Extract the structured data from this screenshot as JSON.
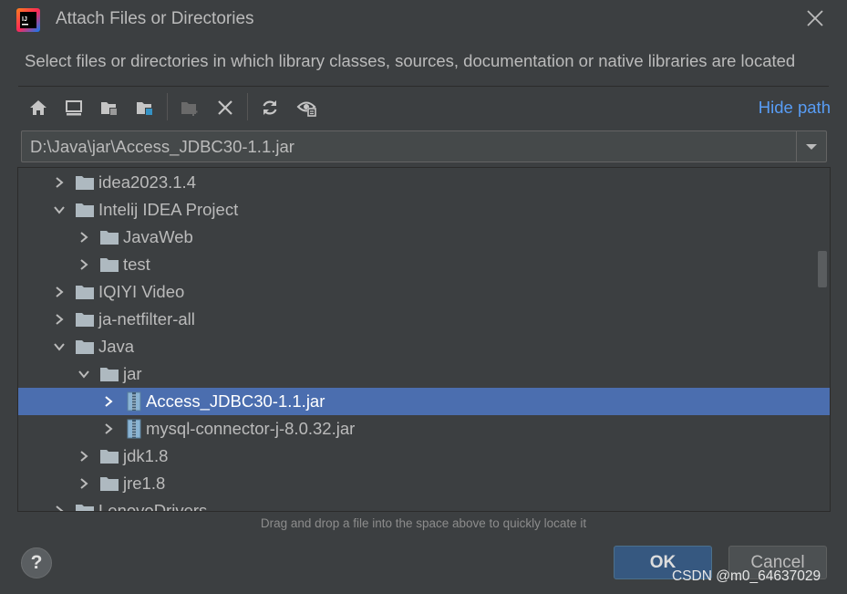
{
  "dialog": {
    "title": "Attach Files or Directories",
    "description": "Select files or directories in which library classes, sources, documentation or native libraries are located",
    "app_icon": "intellij-idea-icon",
    "close_icon": "close-icon"
  },
  "toolbar": {
    "buttons": [
      "home-icon",
      "desktop-icon",
      "project-folder-icon",
      "module-folder-icon",
      "new-folder-icon",
      "delete-icon",
      "refresh-icon",
      "show-hidden-icon"
    ],
    "hide_path_label": "Hide path"
  },
  "path_field": {
    "value": "D:\\Java\\jar\\Access_JDBC30-1.1.jar"
  },
  "tree": {
    "rows": [
      {
        "label": "idea2023.1.4",
        "expanded": false,
        "type": "folder",
        "level": 1
      },
      {
        "label": "Intelij IDEA Project",
        "expanded": true,
        "type": "folder",
        "level": 1
      },
      {
        "label": "JavaWeb",
        "expanded": false,
        "type": "folder",
        "level": 2
      },
      {
        "label": "test",
        "expanded": false,
        "type": "folder",
        "level": 2
      },
      {
        "label": "IQIYI Video",
        "expanded": false,
        "type": "folder",
        "level": 1
      },
      {
        "label": "ja-netfilter-all",
        "expanded": false,
        "type": "folder",
        "level": 1
      },
      {
        "label": "Java",
        "expanded": true,
        "type": "folder",
        "level": 1
      },
      {
        "label": "jar",
        "expanded": true,
        "type": "folder",
        "level": 2
      },
      {
        "label": "Access_JDBC30-1.1.jar",
        "expanded": false,
        "type": "jar",
        "level": 3,
        "selected": true
      },
      {
        "label": "mysql-connector-j-8.0.32.jar",
        "expanded": false,
        "type": "jar",
        "level": 3
      },
      {
        "label": "jdk1.8",
        "expanded": false,
        "type": "folder",
        "level": 2
      },
      {
        "label": "jre1.8",
        "expanded": false,
        "type": "folder",
        "level": 2
      },
      {
        "label": "LenovoDrivers",
        "expanded": false,
        "type": "folder",
        "level": 1
      }
    ]
  },
  "hint": "Drag and drop a file into the space above to quickly locate it",
  "buttons": {
    "help": "?",
    "ok": "OK",
    "cancel": "Cancel"
  },
  "watermark": "CSDN @m0_64637029",
  "colors": {
    "background": "#3c3f41",
    "selection": "#4b6eaf",
    "link": "#589df6",
    "ok_button": "#365880"
  }
}
